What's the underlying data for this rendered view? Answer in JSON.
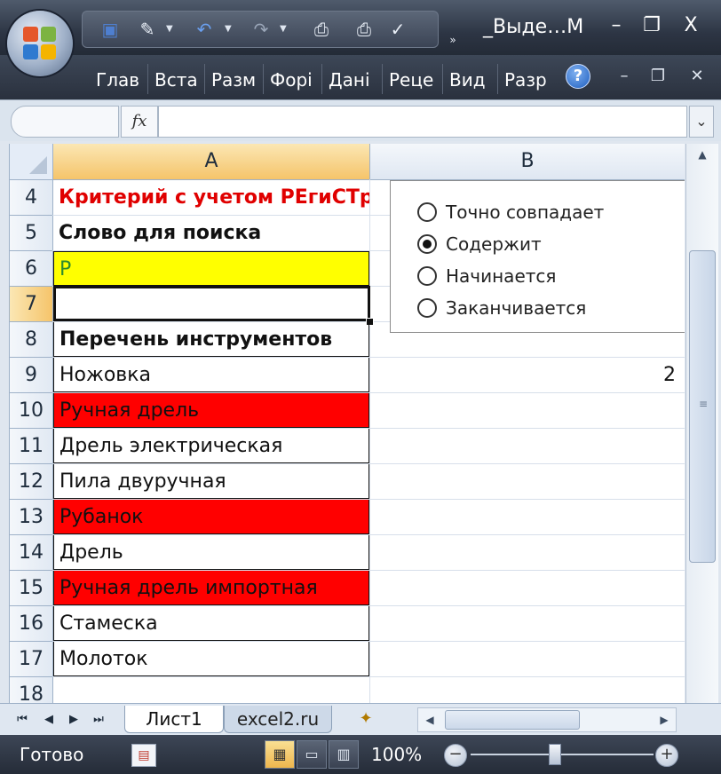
{
  "window": {
    "title": "_Выде…М",
    "minimize_label": "–",
    "restore_label": "❐",
    "close_label": "X"
  },
  "quick_access": {
    "save_icon": "save-icon",
    "undo_icon": "undo-icon",
    "redo_icon": "redo-icon",
    "print_icon": "print-icon",
    "more": "»"
  },
  "ribbon": {
    "tabs": [
      "Глав",
      "Вста",
      "Разм",
      "Форі",
      "Дані",
      "Реце",
      "Вид",
      "Разр"
    ],
    "help": "?"
  },
  "formula_bar": {
    "fx_label": "fx",
    "expand": "¥"
  },
  "grid": {
    "columns": [
      "A",
      "B"
    ],
    "rows": [
      "4",
      "5",
      "6",
      "7",
      "8",
      "9",
      "10",
      "11",
      "12",
      "13",
      "14",
      "15",
      "16",
      "17",
      "18"
    ],
    "cells": {
      "a4": "Критерий с учетом РЕгиСТра",
      "a5": "Слово для поиска",
      "a6": "Р",
      "a7": "",
      "a8": "Перечень инструментов",
      "a9": "Ножовка",
      "a10": "Ручная дрель",
      "a11": "Дрель электрическая",
      "a12": "Пила двуручная",
      "a13": "Рубанок",
      "a14": "Дрель",
      "a15": "Ручная дрель импортная",
      "a16": "Стамеска",
      "a17": "Молоток",
      "b9": "2"
    },
    "colors": {
      "header_text_red": "#e00000",
      "search_fill": "#ffff00",
      "match_fill": "#ff0000",
      "search_text": "#2e8b2e"
    }
  },
  "radio_group": {
    "options": [
      "Точно совпадает",
      "Содержит",
      "Начинается",
      "Заканчивается"
    ],
    "selected": "Содержит"
  },
  "sheets": {
    "tabs": [
      "Лист1",
      "excel2.ru"
    ],
    "active": "Лист1"
  },
  "status": {
    "text": "Готово",
    "zoom": "100%",
    "zoom_minus": "−",
    "zoom_plus": "+"
  }
}
